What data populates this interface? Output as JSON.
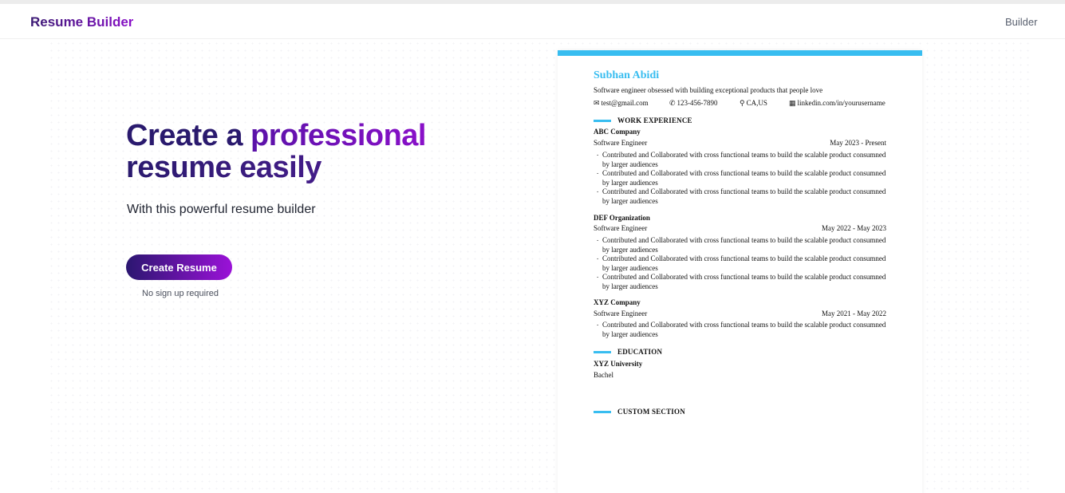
{
  "nav": {
    "brand": "Resume Builder",
    "link": "Builder"
  },
  "hero": {
    "title_part1": "Create a ",
    "title_accent": "professional",
    "title_part2": "resume easily",
    "subtitle": "With this powerful resume builder",
    "cta_label": "Create Resume",
    "cta_note": "No sign up required"
  },
  "resume": {
    "accent_color": "#38bdf0",
    "name": "Subhan Abidi",
    "summary": "Software engineer obsessed with building exceptional products that people love",
    "contacts": [
      {
        "icon": "mail-icon",
        "glyph": "✉",
        "text": "test@gmail.com"
      },
      {
        "icon": "phone-icon",
        "glyph": "✆",
        "text": "123-456-7890"
      },
      {
        "icon": "location-pin-icon",
        "glyph": "⚲",
        "text": "CA,US"
      },
      {
        "icon": "linkedin-icon",
        "glyph": "▦",
        "text": "linkedin.com/in/yourusername"
      }
    ],
    "sections": {
      "work": "WORK EXPERIENCE",
      "education": "EDUCATION",
      "custom": "CUSTOM SECTION"
    },
    "jobs": [
      {
        "company": "ABC Company",
        "role": "Software Engineer",
        "dates": "May 2023 - Present",
        "bullets": [
          "Contributed and Collaborated with cross functional teams to build the scalable product consumned by larger audiences",
          "Contributed and Collaborated with cross functional teams to build the scalable product consumned by larger audiences",
          "Contributed and Collaborated with cross functional teams to build the scalable product consumned by larger audiences"
        ]
      },
      {
        "company": "DEF Organization",
        "role": "Software Engineer",
        "dates": "May 2022 - May 2023",
        "bullets": [
          "Contributed and Collaborated with cross functional teams to build the scalable product consumned by larger audiences",
          "Contributed and Collaborated with cross functional teams to build the scalable product consumned by larger audiences",
          "Contributed and Collaborated with cross functional teams to build the scalable product consumned by larger audiences"
        ]
      },
      {
        "company": "XYZ Company",
        "role": "Software Engineer",
        "dates": "May 2021 - May 2022",
        "bullets": [
          "Contributed and Collaborated with cross functional teams to build the scalable product consumned by larger audiences"
        ]
      }
    ],
    "education": {
      "school": "XYZ University",
      "degree": "Bachel"
    }
  }
}
